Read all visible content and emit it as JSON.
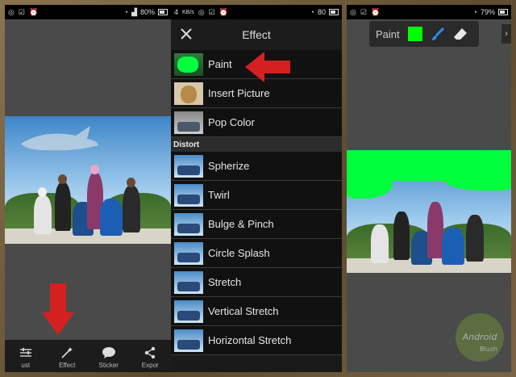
{
  "status_bars": [
    {
      "time_fragment": "",
      "battery": "80%",
      "signal_text": ""
    },
    {
      "left": "4",
      "speed": "KB/s",
      "battery": "80"
    },
    {
      "battery": "79%"
    }
  ],
  "panel1": {
    "tools": [
      {
        "label": "ust",
        "icon": "sliders-icon"
      },
      {
        "label": "Effect",
        "icon": "magic-wand-icon"
      },
      {
        "label": "Sticker",
        "icon": "speech-bubble-icon"
      },
      {
        "label": "Expor",
        "icon": "share-icon"
      }
    ]
  },
  "panel2": {
    "title": "Effect",
    "items_top": [
      "Paint",
      "Insert Picture",
      "Pop Color"
    ],
    "section": "Distort",
    "items_distort": [
      "Spherize",
      "Twirl",
      "Bulge & Pinch",
      "Circle Splash",
      "Stretch",
      "Vertical Stretch",
      "Horizontal Stretch"
    ]
  },
  "panel3": {
    "toolbar_label": "Paint",
    "paint_color": "#00ff00",
    "brush_icon": "brush-icon",
    "eraser_icon": "eraser-icon"
  },
  "watermark": {
    "line1": "Android",
    "line2": "Blush"
  },
  "colors": {
    "arrow": "#d42020",
    "paint": "#00ff00",
    "bar": "#1c1c1c"
  }
}
